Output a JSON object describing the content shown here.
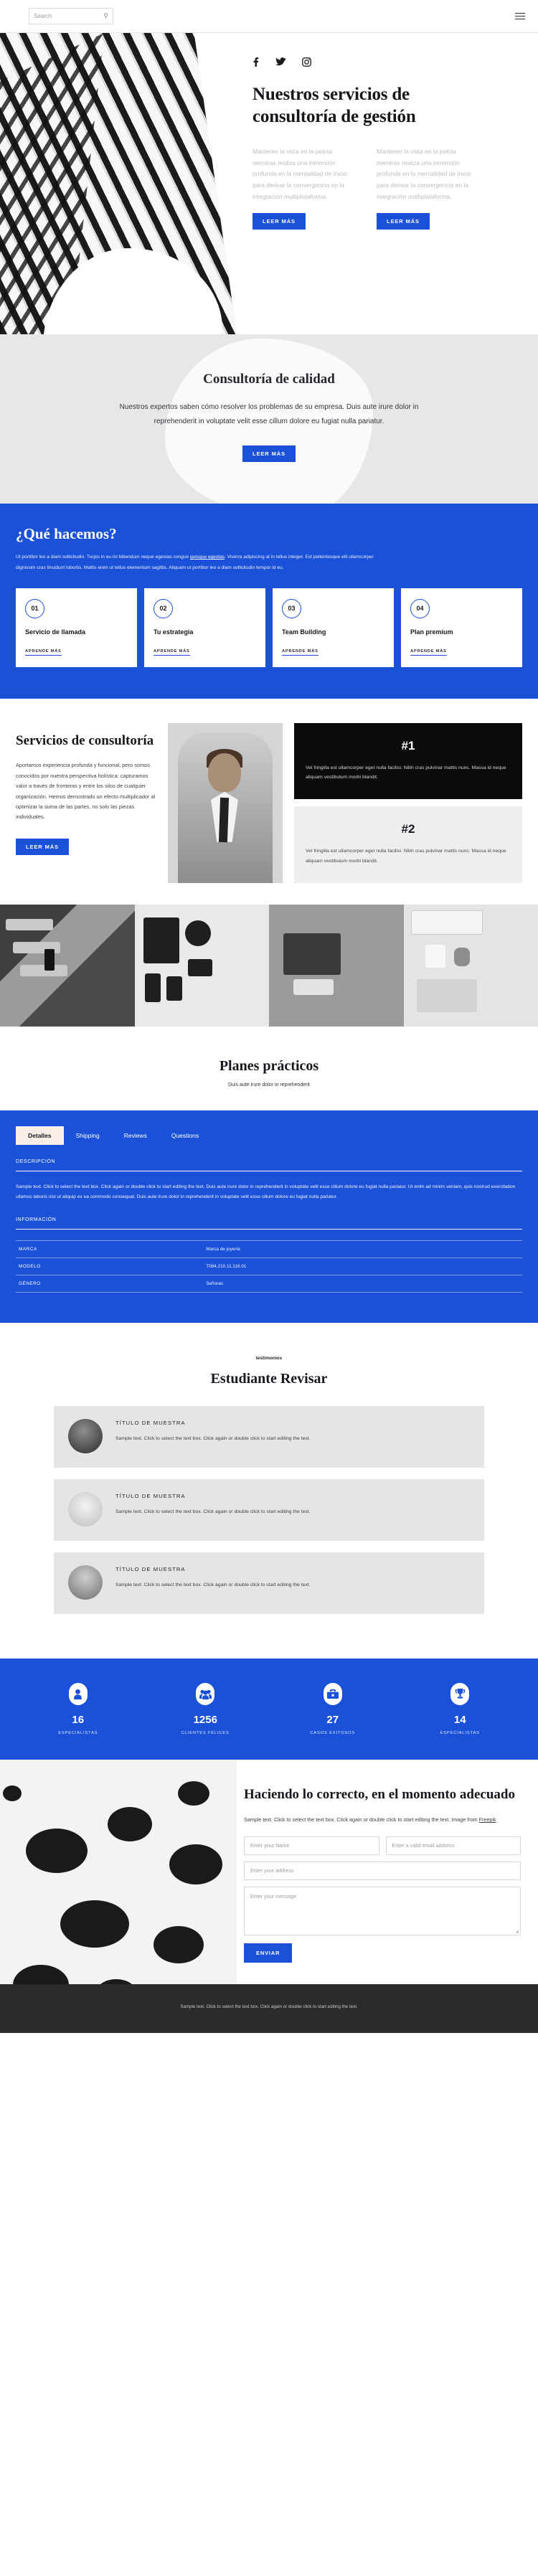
{
  "topbar": {
    "search_placeholder": "Search",
    "search_icon": "search-icon",
    "menu_icon": "hamburger-menu-icon"
  },
  "hero": {
    "social": [
      {
        "name": "facebook-icon",
        "glyph": "f"
      },
      {
        "name": "twitter-icon",
        "glyph": "🐦"
      },
      {
        "name": "instagram-icon",
        "glyph": "▣"
      }
    ],
    "title": "Nuestros servicios de consultoría de gestión",
    "columns": [
      {
        "text": "Mantener la vista en la pelota mientras realiza una inmersión profunda en la mentalidad de inicio para derivar la convergencia en la integración multiplataforma.",
        "button": "LEER MÁS"
      },
      {
        "text": "Mantener la vista en la pelota mientras realiza una inmersión profunda en la mentalidad de inicio para derivar la convergencia en la integración multiplataforma.",
        "button": "LEER MÁS"
      }
    ]
  },
  "quality": {
    "heading": "Consultoría de calidad",
    "body": "Nuestros expertos saben cómo resolver los problemas de su empresa. Duis aute irure dolor in reprehenderit in voluptate velit esse cillum dolore eu fugiat nulla pariatur.",
    "button": "LEER MÁS"
  },
  "whatwedo": {
    "heading": "¿Qué hacemos?",
    "lede_1": "Ut porttitor leo a diam sollicitudin. Turpis in eu mi bibendum neque egestas congue ",
    "lede_link": "quisque egestas",
    "lede_2": ". Viverra adipiscing at in tellus integer. Est pellentesque elit ullamcorper dignissim cras tincidunt lobortis. Mattis enim ut tellus elementum sagittis. Aliquam ut porttitor leo a diam sollicitudin tempor id eu.",
    "cards": [
      {
        "num": "01",
        "title": "Servicio de llamada",
        "link": "APRENDE MÁS"
      },
      {
        "num": "02",
        "title": "Tu estrategia",
        "link": "APRENDE MÁS"
      },
      {
        "num": "03",
        "title": "Team Building",
        "link": "APRENDE MÁS"
      },
      {
        "num": "04",
        "title": "Plan premium",
        "link": "APRENDE MÁS"
      }
    ],
    "accent": "#1b51d8"
  },
  "services": {
    "heading": "Servicios de consultoría",
    "body": "Aportamos experiencia profunda y funcional, pero somos conocidos por nuestra perspectiva holística: capturamos valor a través de fronteras y entre los silos de cualquier organización. Hemos demostrado un efecto multiplicador al optimizar la suma de las partes, no solo las piezas individuales.",
    "button": "LEER MÁS",
    "ranks": [
      {
        "title": "#1",
        "body": "Vel fringilla est ullamcorper eget nulla facilisi. Nibh cras pulvinar mattis nunc. Massa id neque aliquam vestibulum morbi blandit."
      },
      {
        "title": "#2",
        "body": "Vel fringilla est ullamcorper eget nulla facilisi. Nibh cras pulvinar mattis nunc. Massa id neque aliquam vestibulum morbi blandit."
      }
    ]
  },
  "plans": {
    "heading": "Planes prácticos",
    "subheading": "Duis aute irure dolor in reprehenderit",
    "tabs": [
      {
        "label": "Detalles",
        "active": true
      },
      {
        "label": "Shipping",
        "active": false
      },
      {
        "label": "Reviews",
        "active": false
      },
      {
        "label": "Questions",
        "active": false
      }
    ],
    "description_label": "DESCRIPCIÓN",
    "description_body": "Sample text. Click to select the text box. Click again or double click to start editing the text. Duis aute irure dolor in reprehenderit in voluptate velit esse cillum dolore eu fugiat nulla pariatur. Ut enim ad minim veniam, quis nostrud exercitation ullamco laboris nisi ut aliquip ex ea commodo consequat. Duis aute irure dolor in reprehenderit in voluptate velit esse cillum dolore eu fugiat nulla pariatur.",
    "information_label": "INFORMACIÓN",
    "info_rows": [
      {
        "key": "MARCA",
        "value": "Marca de joyería"
      },
      {
        "key": "MODELO",
        "value": "T084.210.11.116.01"
      },
      {
        "key": "GÉNERO",
        "value": "Señoras"
      }
    ]
  },
  "testimonials": {
    "kicker": "testimonios",
    "heading": "Estudiante Revisar",
    "items": [
      {
        "title": "TÍTULO DE MUESTRA",
        "body": "Sample text. Click to select the text box. Click again or double click to start editing the text.",
        "avatar": "avatar-female-dark"
      },
      {
        "title": "TÍTULO DE MUESTRA",
        "body": "Sample text. Click to select the text box. Click again or double click to start editing the text.",
        "avatar": "avatar-light"
      },
      {
        "title": "TÍTULO DE MUESTRA",
        "body": "Sample text. Click to select the text box. Click again or double click to start editing the text.",
        "avatar": "avatar-male"
      }
    ]
  },
  "stats": [
    {
      "icon": "person-icon",
      "number": "16",
      "label": "ESPECIALISTAS"
    },
    {
      "icon": "group-icon",
      "number": "1256",
      "label": "CLIENTES FELICES"
    },
    {
      "icon": "briefcase-icon",
      "number": "27",
      "label": "CASOS EXITOSOS"
    },
    {
      "icon": "trophy-icon",
      "number": "14",
      "label": "ESPECIALISTAS"
    }
  ],
  "contact": {
    "heading": "Haciendo lo correcto, en el momento adecuado",
    "sub_1": "Sample text. Click to select the text box. Click again or double click to start editing the text. Image from ",
    "sub_link": "Freepik",
    "fields": {
      "name_placeholder": "Enter your Name",
      "email_placeholder": "Enter a valid email address",
      "address_placeholder": "Enter your address",
      "message_placeholder": "Enter your message"
    },
    "submit": "ENVIAR"
  },
  "footer": {
    "text": "Sample text. Click to select the text box. Click again or double click to start editing the text."
  }
}
